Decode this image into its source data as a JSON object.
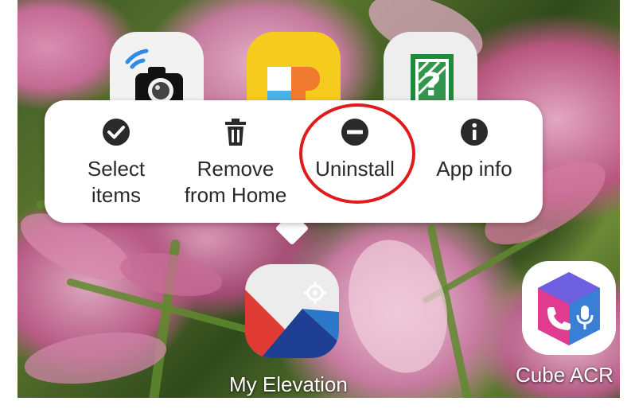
{
  "home_screen": {
    "top_apps": [
      {
        "icon": "camera-remote-icon"
      },
      {
        "icon": "photo-frame-p-icon"
      },
      {
        "icon": "puzzle-shield-icon"
      }
    ],
    "popup_menu": {
      "items": [
        {
          "label": "Select\nitems",
          "icon": "checkmark-circle-icon"
        },
        {
          "label": "Remove\nfrom Home",
          "icon": "trash-icon"
        },
        {
          "label": "Uninstall",
          "icon": "minus-circle-icon"
        },
        {
          "label": "App info",
          "icon": "info-circle-icon"
        }
      ],
      "highlight_color": "#e01b1b"
    },
    "apps": [
      {
        "label": "My Elevation",
        "icon": "mountain-elevation-icon"
      },
      {
        "label": "Cube ACR",
        "icon": "cube-call-recorder-icon"
      }
    ]
  }
}
